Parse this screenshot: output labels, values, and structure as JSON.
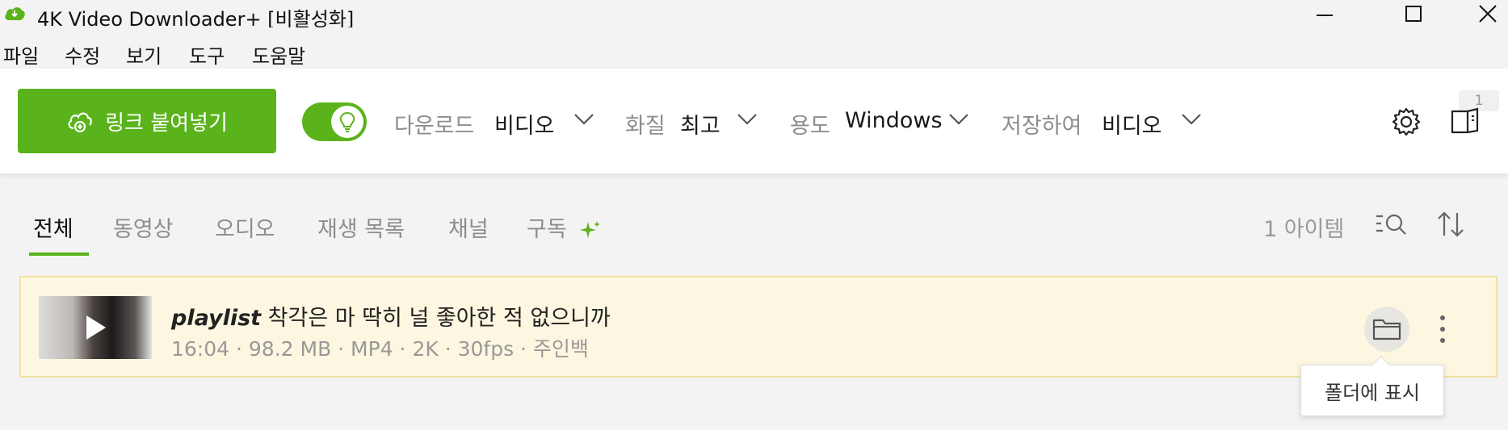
{
  "window": {
    "title": "4K Video Downloader+ [비활성화]",
    "controls": [
      "minimize",
      "maximize",
      "close"
    ]
  },
  "menu": {
    "items": [
      "파일",
      "수정",
      "보기",
      "도구",
      "도움말"
    ]
  },
  "toolbar": {
    "paste_label": "링크 붙여넣기",
    "smart_mode_on": true,
    "download": {
      "label": "다운로드",
      "value": "비디오"
    },
    "quality": {
      "label": "화질",
      "value": "최고"
    },
    "for": {
      "label": "용도",
      "value": "Windows"
    },
    "save_as": {
      "label": "저장하여",
      "value": "비디오"
    },
    "queue_badge": "1",
    "accent_color": "#5ab31b"
  },
  "tabs": {
    "items": [
      "전체",
      "동영상",
      "오디오",
      "재생 목록",
      "채널",
      "구독"
    ],
    "active_index": 0,
    "item_count": "1 아이템"
  },
  "downloads": [
    {
      "tag": "playlist",
      "title": "착각은 마 딱히 널 좋아한 적 없으니까",
      "meta": "16:04 · 98.2 MB · MP4 · 2K · 30fps · 주인백",
      "folder_tooltip": "폴더에 표시"
    }
  ]
}
